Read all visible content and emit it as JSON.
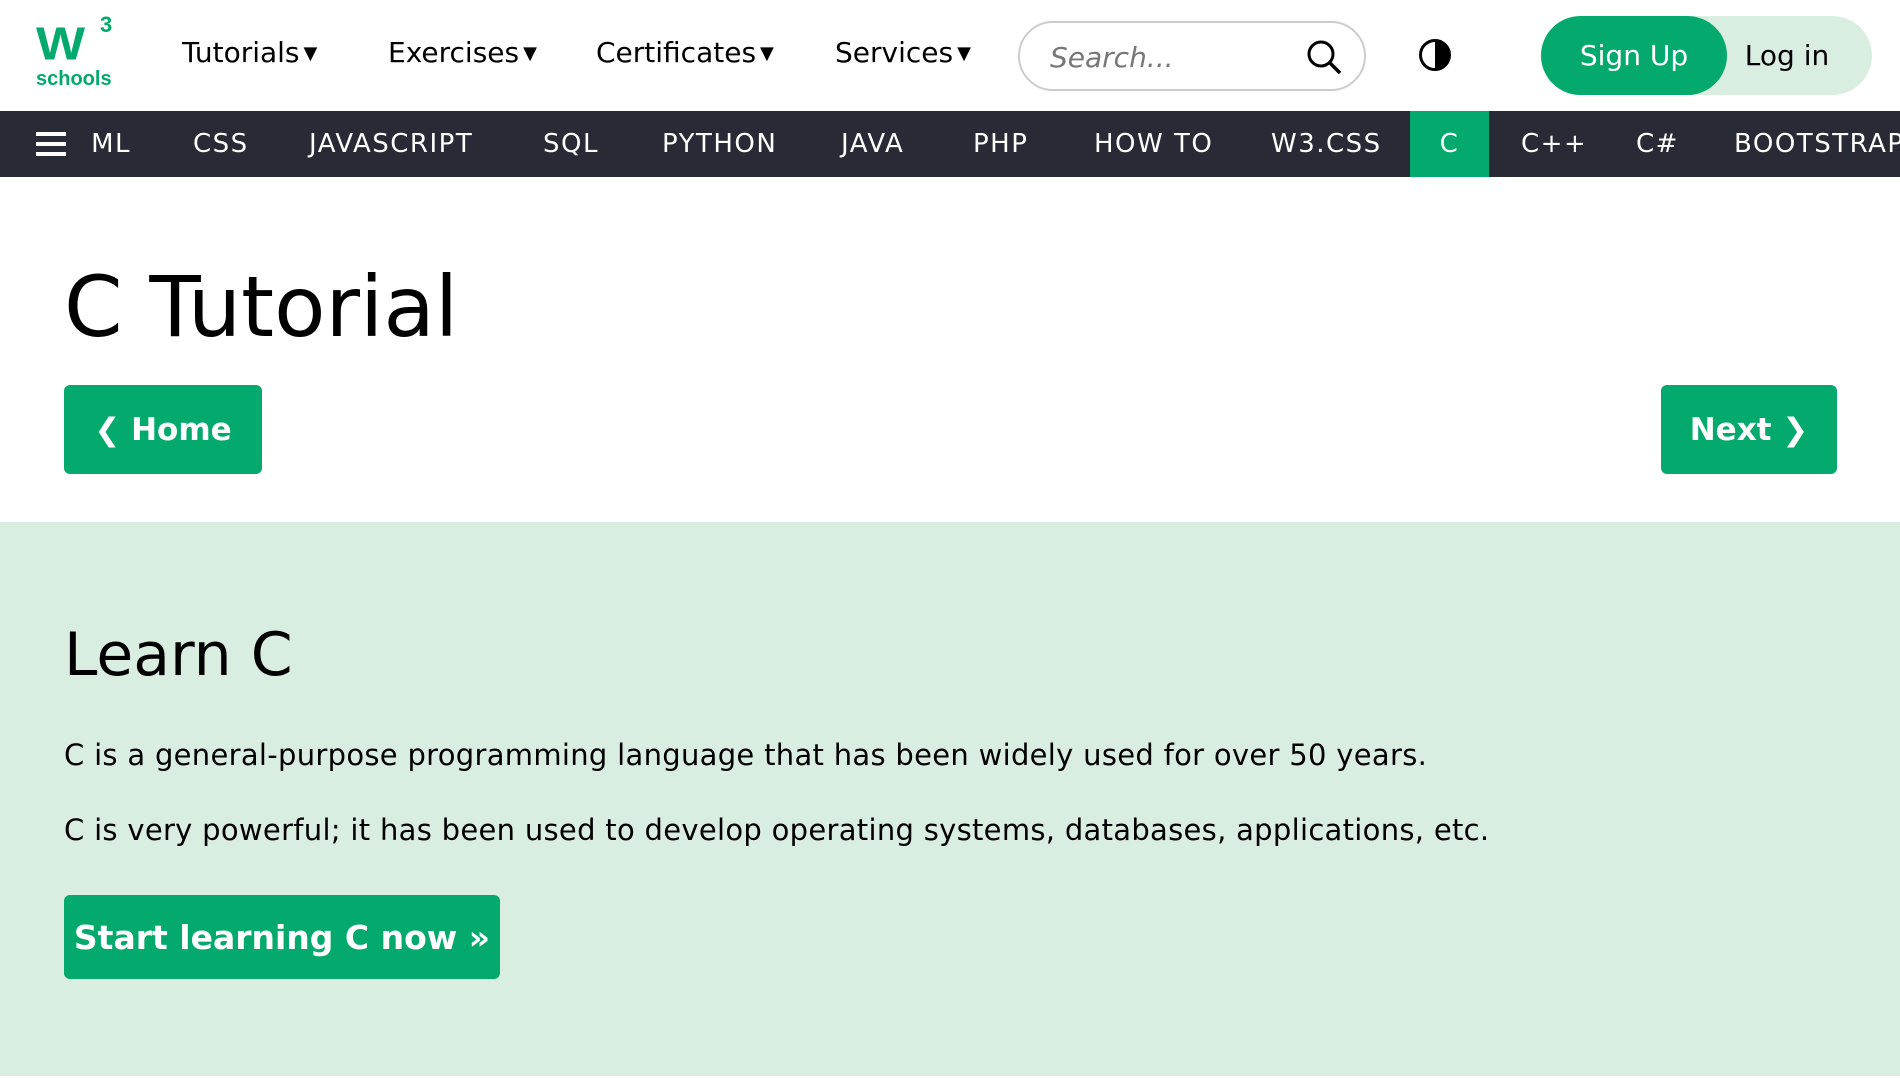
{
  "logo": {
    "main": "W",
    "sup": "3",
    "sub": "schools"
  },
  "header": {
    "menus": [
      {
        "label": "Tutorials"
      },
      {
        "label": "Exercises"
      },
      {
        "label": "Certificates"
      },
      {
        "label": "Services"
      }
    ],
    "caret": "▼",
    "search_placeholder": "Search...",
    "signup": "Sign Up",
    "login": "Log in"
  },
  "navbar": {
    "items": [
      "ML",
      "CSS",
      "JAVASCRIPT",
      "SQL",
      "PYTHON",
      "JAVA",
      "PHP",
      "HOW TO",
      "W3.CSS",
      "C",
      "C++",
      "C#",
      "BOOTSTRAP"
    ],
    "active": "C"
  },
  "main": {
    "title": "C Tutorial",
    "prev": "❮ Home",
    "next": "Next ❯",
    "section_title": "Learn C",
    "paragraphs": [
      "C is a general-purpose programming language that has been widely used for over 50 years.",
      "C is very powerful; it has been used to develop operating systems, databases, applications, etc."
    ],
    "cta": "Start learning C now »"
  },
  "colors": {
    "brand": "#04AA6D",
    "nav": "#282A35",
    "section": "#D9EEE1"
  }
}
